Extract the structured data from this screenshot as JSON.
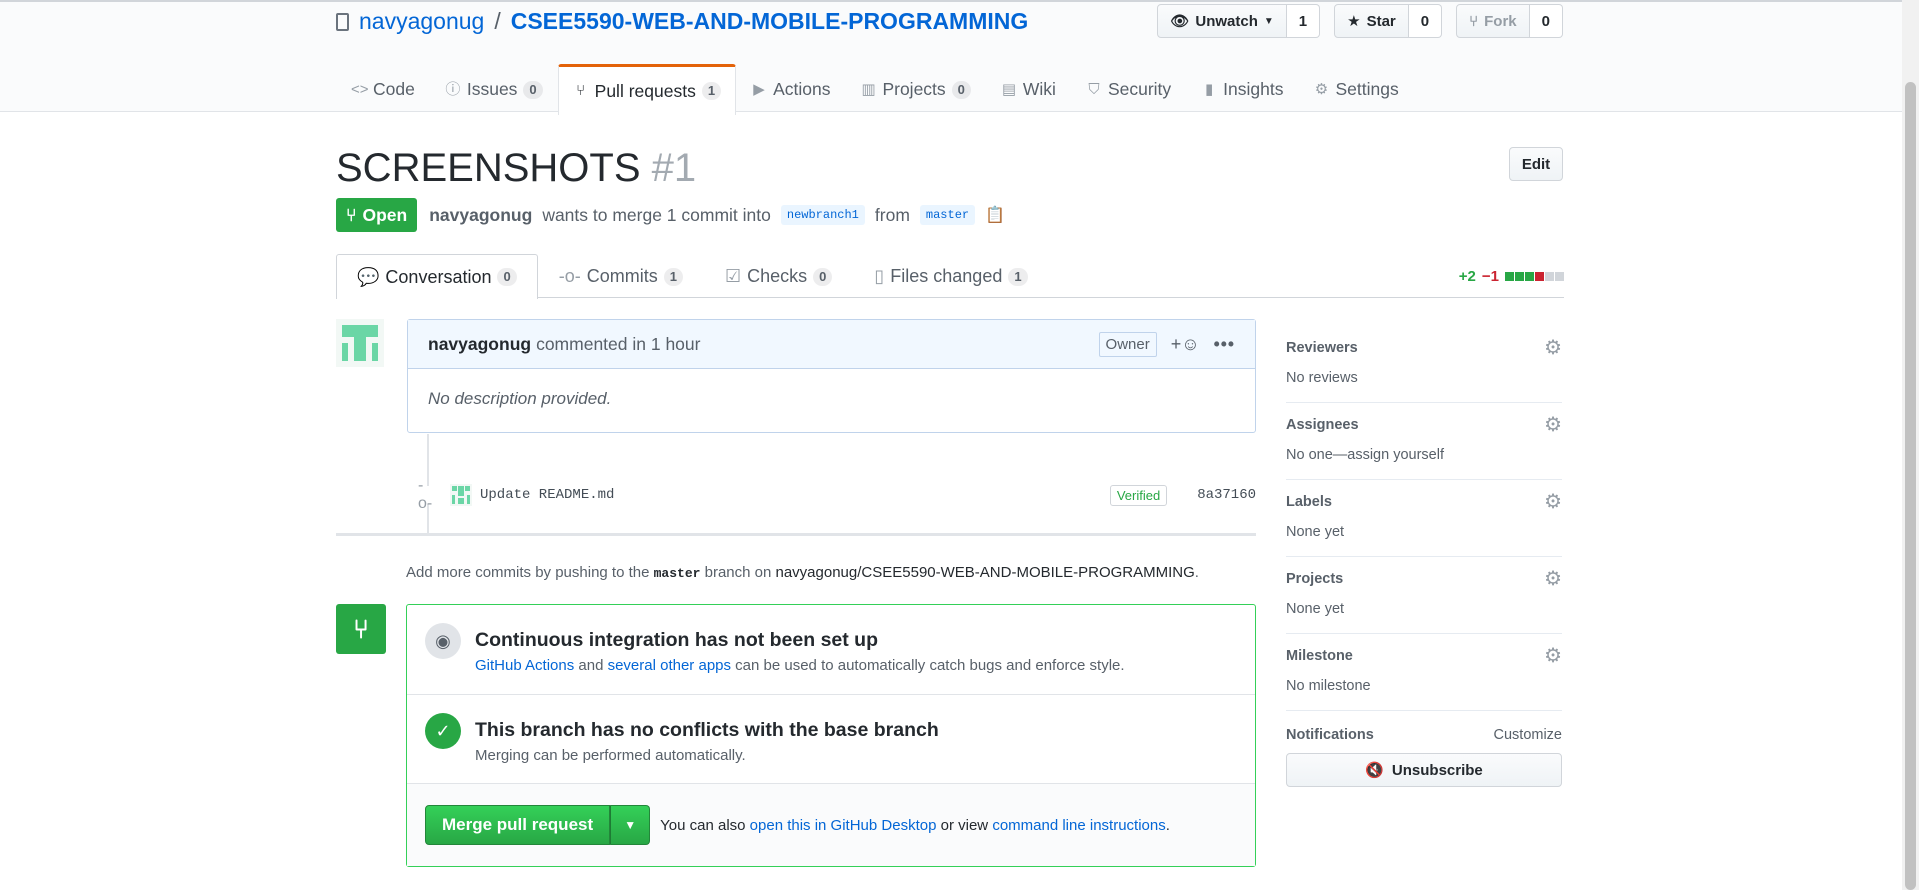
{
  "repo": {
    "owner": "navyagonug",
    "separator": "/",
    "name": "CSEE5590-WEB-AND-MOBILE-PROGRAMMING"
  },
  "actions": {
    "watch": {
      "label": "Unwatch",
      "count": "1"
    },
    "star": {
      "label": "Star",
      "count": "0"
    },
    "fork": {
      "label": "Fork",
      "count": "0"
    }
  },
  "nav": [
    {
      "label": "Code",
      "icon": "code-icon"
    },
    {
      "label": "Issues",
      "count": "0",
      "icon": "issue-icon"
    },
    {
      "label": "Pull requests",
      "count": "1",
      "icon": "pull-request-icon"
    },
    {
      "label": "Actions",
      "icon": "play-icon"
    },
    {
      "label": "Projects",
      "count": "0",
      "icon": "project-icon"
    },
    {
      "label": "Wiki",
      "icon": "book-icon"
    },
    {
      "label": "Security",
      "icon": "shield-icon"
    },
    {
      "label": "Insights",
      "icon": "graph-icon"
    },
    {
      "label": "Settings",
      "icon": "gear-icon"
    }
  ],
  "pr": {
    "title": "SCREENSHOTS",
    "number": "#1",
    "edit_label": "Edit",
    "state": "Open",
    "author": "navyagonug",
    "merge_text": "wants to merge 1 commit into",
    "base_branch": "newbranch1",
    "from_text": "from",
    "head_branch": "master"
  },
  "tabs": [
    {
      "label": "Conversation",
      "count": "0"
    },
    {
      "label": "Commits",
      "count": "1"
    },
    {
      "label": "Checks",
      "count": "0"
    },
    {
      "label": "Files changed",
      "count": "1"
    }
  ],
  "diffstat": {
    "additions": "+2",
    "deletions": "−1",
    "colors": [
      "#28a745",
      "#28a745",
      "#28a745",
      "#cb2431",
      "#d1d5da",
      "#d1d5da"
    ]
  },
  "comment": {
    "author": "navyagonug",
    "action": "commented in 1 hour",
    "owner_label": "Owner",
    "reaction": "+☺",
    "body": "No description provided."
  },
  "commit": {
    "message": "Update README.md",
    "verified": "Verified",
    "sha": "8a37160"
  },
  "push_hint": {
    "prefix": "Add more commits by pushing to the",
    "branch": "master",
    "middle": "branch on",
    "repo": "navyagonug/CSEE5590-WEB-AND-MOBILE-PROGRAMMING",
    "suffix": "."
  },
  "merge": {
    "ci_title": "Continuous integration has not been set up",
    "ci_link1": "GitHub Actions",
    "ci_and": "and",
    "ci_link2": "several other apps",
    "ci_rest": "can be used to automatically catch bugs and enforce style.",
    "conflict_title": "This branch has no conflicts with the base branch",
    "conflict_desc": "Merging can be performed automatically.",
    "button": "Merge pull request",
    "alt_prefix": "You can also",
    "alt_link1": "open this in GitHub Desktop",
    "alt_or": "or view",
    "alt_link2": "command line instructions",
    "alt_suffix": "."
  },
  "sidebar": {
    "reviewers": {
      "label": "Reviewers",
      "value": "No reviews"
    },
    "assignees": {
      "label": "Assignees",
      "value": "No one—assign yourself"
    },
    "labels": {
      "label": "Labels",
      "value": "None yet"
    },
    "projects": {
      "label": "Projects",
      "value": "None yet"
    },
    "milestone": {
      "label": "Milestone",
      "value": "No milestone"
    },
    "notifications": {
      "label": "Notifications",
      "customize": "Customize",
      "unsubscribe": "Unsubscribe"
    }
  }
}
